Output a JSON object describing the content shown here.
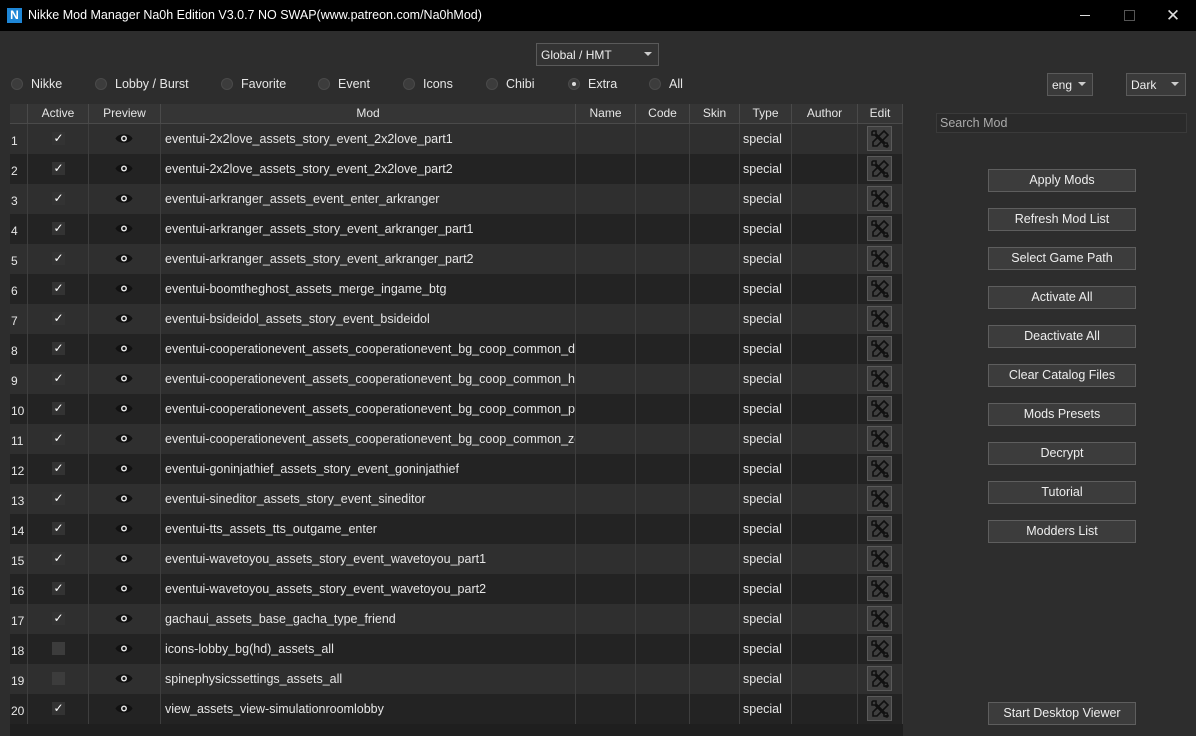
{
  "window": {
    "title": "Nikke Mod Manager Na0h Edition V3.0.7 NO SWAP(www.patreon.com/Na0hMod)",
    "app_icon": "N",
    "close_glyph": "✕"
  },
  "region": {
    "selected": "Global / HMT"
  },
  "language": {
    "selected": "eng"
  },
  "theme": {
    "selected": "Dark"
  },
  "filters": [
    {
      "label": "Nikke",
      "selected": false
    },
    {
      "label": "Lobby / Burst",
      "selected": false
    },
    {
      "label": "Favorite",
      "selected": false
    },
    {
      "label": "Event",
      "selected": false
    },
    {
      "label": "Icons",
      "selected": false
    },
    {
      "label": "Chibi",
      "selected": false
    },
    {
      "label": "Extra",
      "selected": true
    },
    {
      "label": "All",
      "selected": false
    }
  ],
  "table": {
    "headers": {
      "active": "Active",
      "preview": "Preview",
      "mod": "Mod",
      "name": "Name",
      "code": "Code",
      "skin": "Skin",
      "type": "Type",
      "author": "Author",
      "edit": "Edit"
    },
    "rows": [
      {
        "num": "1",
        "active": true,
        "mod": "eventui-2x2love_assets_story_event_2x2love_part1",
        "type": "special"
      },
      {
        "num": "2",
        "active": true,
        "mod": "eventui-2x2love_assets_story_event_2x2love_part2",
        "type": "special"
      },
      {
        "num": "3",
        "active": true,
        "mod": "eventui-arkranger_assets_event_enter_arkranger",
        "type": "special"
      },
      {
        "num": "4",
        "active": true,
        "mod": "eventui-arkranger_assets_story_event_arkranger_part1",
        "type": "special"
      },
      {
        "num": "5",
        "active": true,
        "mod": "eventui-arkranger_assets_story_event_arkranger_part2",
        "type": "special"
      },
      {
        "num": "6",
        "active": true,
        "mod": "eventui-boomtheghost_assets_merge_ingame_btg",
        "type": "special"
      },
      {
        "num": "7",
        "active": true,
        "mod": "eventui-bsideidol_assets_story_event_bsideidol",
        "type": "special"
      },
      {
        "num": "8",
        "active": true,
        "mod": "eventui-cooperationevent_assets_cooperationevent_bg_coop_common_dmtr",
        "type": "special"
      },
      {
        "num": "9",
        "active": true,
        "mod": "eventui-cooperationevent_assets_cooperationevent_bg_coop_common_hsta",
        "type": "special"
      },
      {
        "num": "10",
        "active": true,
        "mod": "eventui-cooperationevent_assets_cooperationevent_bg_coop_common_psid",
        "type": "special"
      },
      {
        "num": "11",
        "active": true,
        "mod": "eventui-cooperationevent_assets_cooperationevent_bg_coop_common_zeus",
        "type": "special"
      },
      {
        "num": "12",
        "active": true,
        "mod": "eventui-goninjathief_assets_story_event_goninjathief",
        "type": "special"
      },
      {
        "num": "13",
        "active": true,
        "mod": "eventui-sineditor_assets_story_event_sineditor",
        "type": "special"
      },
      {
        "num": "14",
        "active": true,
        "mod": "eventui-tts_assets_tts_outgame_enter",
        "type": "special"
      },
      {
        "num": "15",
        "active": true,
        "mod": "eventui-wavetoyou_assets_story_event_wavetoyou_part1",
        "type": "special"
      },
      {
        "num": "16",
        "active": true,
        "mod": "eventui-wavetoyou_assets_story_event_wavetoyou_part2",
        "type": "special"
      },
      {
        "num": "17",
        "active": true,
        "mod": "gachaui_assets_base_gacha_type_friend",
        "type": "special"
      },
      {
        "num": "18",
        "active": false,
        "mod": "icons-lobby_bg(hd)_assets_all",
        "type": "special"
      },
      {
        "num": "19",
        "active": false,
        "mod": "spinephysicssettings_assets_all",
        "type": "special"
      },
      {
        "num": "20",
        "active": true,
        "mod": "view_assets_view-simulationroomlobby",
        "type": "special"
      }
    ]
  },
  "search": {
    "placeholder": "Search Mod"
  },
  "buttons": {
    "apply": "Apply Mods",
    "refresh": "Refresh Mod List",
    "select_path": "Select Game Path",
    "activate_all": "Activate All",
    "deactivate_all": "Deactivate All",
    "clear_catalog": "Clear Catalog Files",
    "presets": "Mods Presets",
    "decrypt": "Decrypt",
    "tutorial": "Tutorial",
    "modders": "Modders List",
    "desktop_viewer": "Start Desktop Viewer"
  },
  "icons": {
    "checkbox": "check-icon",
    "preview": "eye-icon",
    "edit": "tools-icon"
  },
  "colors": {
    "background": "#2d2d2d",
    "titlebar": "#000000",
    "app_icon": "#1e86d6",
    "row_odd": "#2f2f2f",
    "row_even": "#232323"
  }
}
